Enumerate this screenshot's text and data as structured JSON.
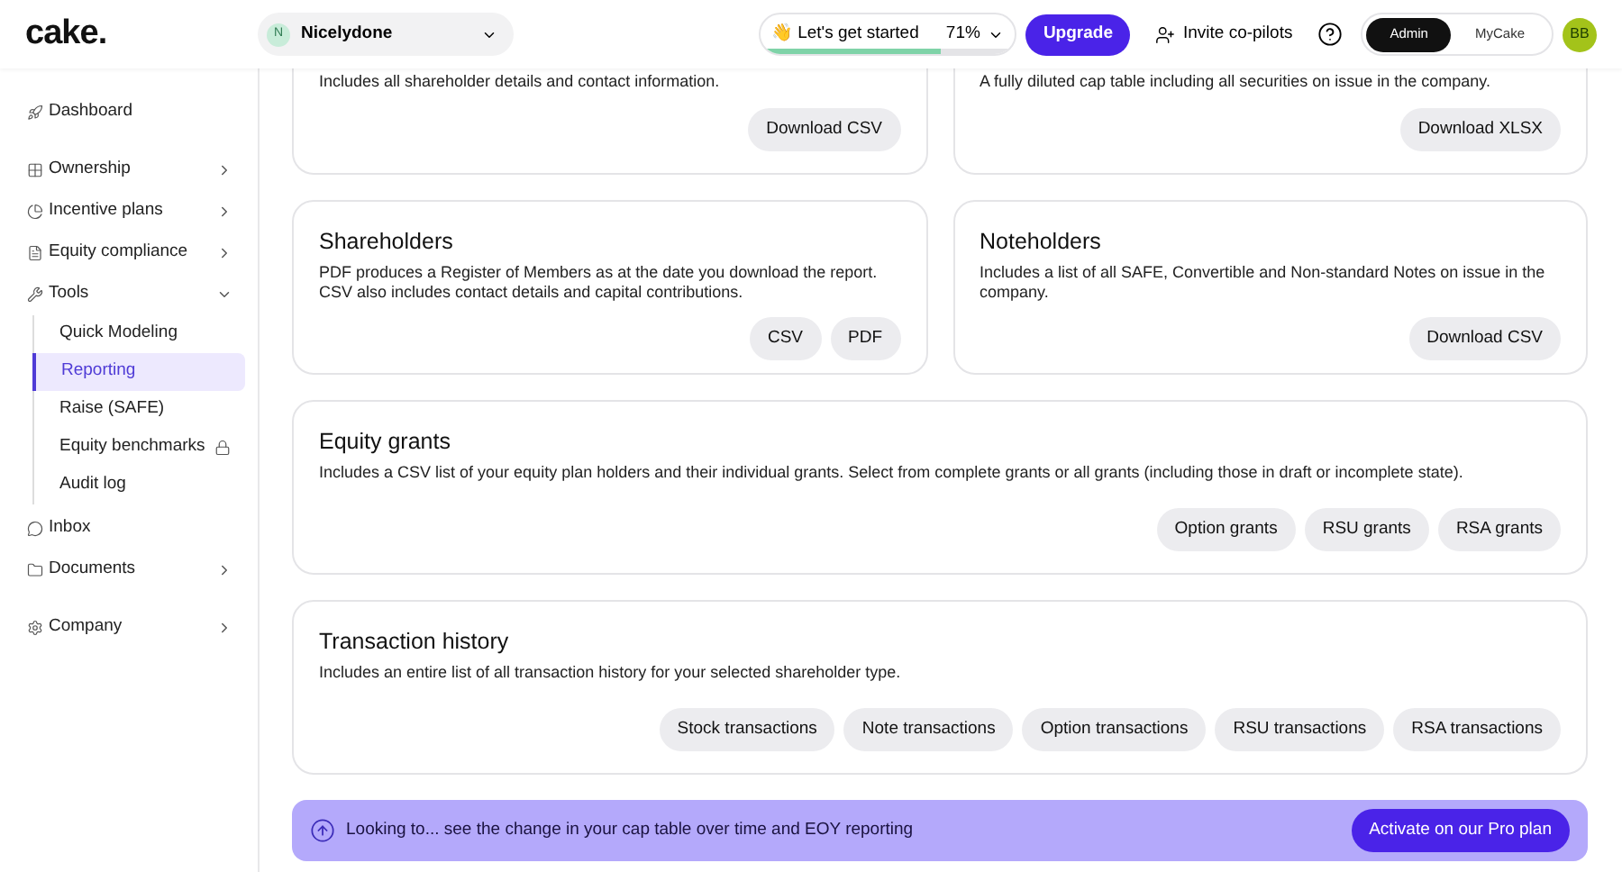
{
  "logo": "cake.",
  "company": {
    "initial": "N",
    "name": "Nicelydone"
  },
  "progress": {
    "label": "👋 Let's get started",
    "percent": "71%",
    "level": 0.71
  },
  "upgrade": "Upgrade",
  "invite": "Invite co-pilots",
  "roles": [
    {
      "label": "Admin",
      "selected": true
    },
    {
      "label": "MyCake",
      "selected": false
    }
  ],
  "avatar": "BB",
  "sidebar": {
    "items": [
      {
        "label": "Dashboard",
        "kind": "link"
      },
      {
        "label": "Ownership",
        "kind": "menu"
      },
      {
        "label": "Incentive plans",
        "kind": "menu"
      },
      {
        "label": "Equity compliance",
        "kind": "menu"
      },
      {
        "label": "Tools",
        "kind": "group",
        "children": [
          {
            "label": "Quick Modeling",
            "selected": false,
            "locked": false
          },
          {
            "label": "Reporting",
            "selected": true,
            "locked": false
          },
          {
            "label": "Raise (SAFE)",
            "selected": false,
            "locked": false
          },
          {
            "label": "Equity benchmarks",
            "selected": false,
            "locked": true
          },
          {
            "label": "Audit log",
            "selected": false,
            "locked": false
          }
        ]
      },
      {
        "label": "Inbox",
        "kind": "link"
      },
      {
        "label": "Documents",
        "kind": "menu"
      },
      {
        "label": "Company",
        "kind": "menu"
      }
    ]
  },
  "cut_cards": [
    {
      "description": "Includes all shareholder details and contact information.",
      "buttons": [
        "Download CSV"
      ]
    },
    {
      "description": "A fully diluted cap table including all securities on issue in the company.",
      "buttons": [
        "Download XLSX"
      ]
    }
  ],
  "pair_cards": [
    {
      "title": "Shareholders",
      "description": "PDF produces a Register of Members as at the date you download the report. CSV also includes contact details and capital contributions.",
      "buttons": [
        "CSV",
        "PDF"
      ]
    },
    {
      "title": "Noteholders",
      "description": "Includes a list of all SAFE, Convertible and Non-standard Notes on issue in the company.",
      "buttons": [
        "Download CSV"
      ]
    }
  ],
  "wide_cards": [
    {
      "title": "Equity grants",
      "description": "Includes a CSV list of your equity plan holders and their individual grants. Select from complete grants or all grants (including those in draft or incomplete state).",
      "buttons": [
        "Option grants",
        "RSU grants",
        "RSA grants"
      ]
    },
    {
      "title": "Transaction history",
      "description": "Includes an entire list of all transaction history for your selected shareholder type.",
      "buttons": [
        "Stock transactions",
        "Note transactions",
        "Option transactions",
        "RSU transactions",
        "RSA transactions"
      ]
    }
  ],
  "banner": {
    "text": "Looking to... see the change in your cap table over time and EOY reporting",
    "button": "Activate on our Pro plan"
  }
}
